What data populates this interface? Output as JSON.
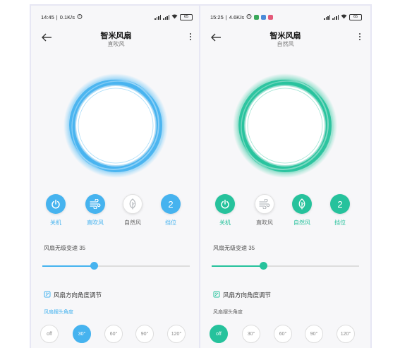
{
  "colors": {
    "blue": "#46b3ef",
    "teal": "#26c29c",
    "inactive_icon": "#b8bcc0",
    "track": "#dddddd"
  },
  "screens": [
    {
      "status_time": "14:45",
      "status_speed": "0.1K/s",
      "battery": "65",
      "title": "智米风扇",
      "subtitle": "直吹风",
      "accent": "#46b3ef",
      "modes": [
        {
          "label": "关机",
          "icon": "power-icon",
          "active": true
        },
        {
          "label": "直吹风",
          "icon": "wind-icon",
          "active": true
        },
        {
          "label": "自然风",
          "icon": "leaf-icon",
          "active": false
        },
        {
          "label": "挡位",
          "icon": "gear-number",
          "active": true,
          "value": "2"
        }
      ],
      "speed_label": "风扇无级变速 35",
      "speed_value": 35,
      "angle_header": "风扇方向角度调节",
      "angle_sub": "风扇摆头角度",
      "angles": [
        "off",
        "30°",
        "60°",
        "90°",
        "120°"
      ],
      "selected_angle": 1
    },
    {
      "status_time": "15:25",
      "status_speed": "4.6K/s",
      "battery": "65",
      "title": "智米风扇",
      "subtitle": "自然风",
      "accent": "#26c29c",
      "modes": [
        {
          "label": "关机",
          "icon": "power-icon",
          "active": true
        },
        {
          "label": "直吹风",
          "icon": "wind-icon",
          "active": false
        },
        {
          "label": "自然风",
          "icon": "leaf-icon",
          "active": true
        },
        {
          "label": "挡位",
          "icon": "gear-number",
          "active": true,
          "value": "2"
        }
      ],
      "speed_label": "风扇无级变速 35",
      "speed_value": 35,
      "angle_header": "风扇方向角度调节",
      "angle_sub": "风扇摆头角度",
      "angles": [
        "off",
        "30°",
        "60°",
        "90°",
        "120°"
      ],
      "selected_angle": 0
    }
  ]
}
